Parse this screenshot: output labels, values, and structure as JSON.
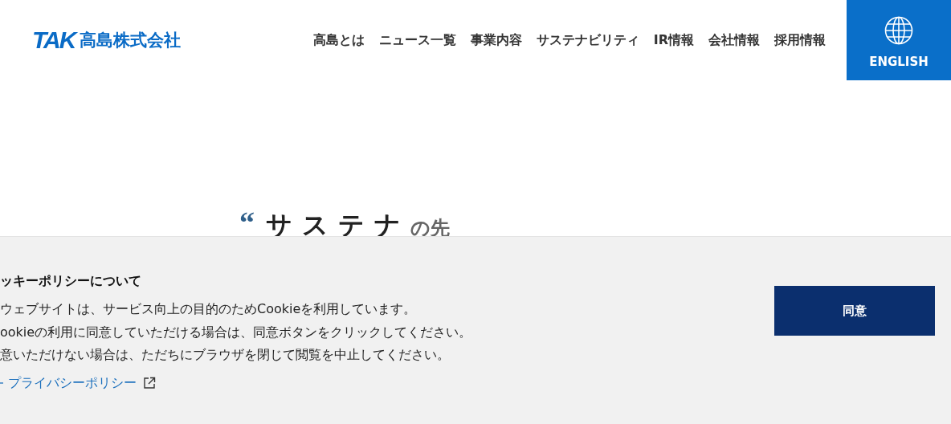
{
  "header": {
    "logo": {
      "mark": "TAK",
      "name": "高島株式会社"
    },
    "nav": [
      {
        "label": "高島とは"
      },
      {
        "label": "ニュース一覧"
      },
      {
        "label": "事業内容"
      },
      {
        "label": "サステナビリティ"
      },
      {
        "label": "IR情報"
      },
      {
        "label": "会社情報"
      },
      {
        "label": "採用情報"
      }
    ],
    "language_button": {
      "label": "ENGLISH"
    }
  },
  "hero": {
    "quote_mark": "“",
    "heading": "サステナ",
    "heading_trail": "の先"
  },
  "cookie_banner": {
    "title": "ッキーポリシーについて",
    "lines": [
      "ウェブサイトは、サービス向上の目的のためCookieを利用しています。",
      "ookieの利用に同意していただける場合は、同意ボタンをクリックしてください。",
      "意いただけない場合は、ただちにブラウザを閉じて閲覧を中止してください。"
    ],
    "link": "プライバシーポリシー",
    "button": "同意"
  }
}
